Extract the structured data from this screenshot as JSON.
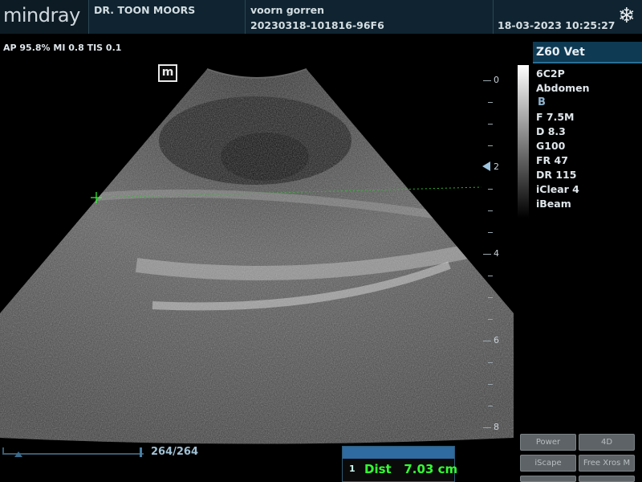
{
  "header": {
    "logo": "mindray",
    "doctor": "DR. TOON MOORS",
    "patient_name": "voorn gorren",
    "exam_id": "20230318-101816-96F6",
    "datetime": "18-03-2023  10:25:27",
    "freeze_icon": "snowflake-icon"
  },
  "acoustic": {
    "params": "AP 95.8%  MI 0.8 TIS 0.1"
  },
  "image": {
    "orientation_mark": "m"
  },
  "sidebar": {
    "model": "Z60 Vet",
    "probe": "6C2P",
    "exam": "Abdomen",
    "mode": "B",
    "settings": [
      "F 7.5M",
      "D 8.3",
      "G100",
      "FR 47",
      "DR 115",
      "iClear 4",
      "iBeam"
    ]
  },
  "depth_scale": [
    "0",
    "2",
    "4",
    "6",
    "8"
  ],
  "cine": {
    "frames": "264/264"
  },
  "measurement": {
    "index": "1",
    "label": "Dist",
    "value": "7.03 cm"
  },
  "buttons": [
    {
      "label": "Power"
    },
    {
      "label": "4D"
    },
    {
      "label": "iScape"
    },
    {
      "label": "Free Xros M"
    }
  ]
}
